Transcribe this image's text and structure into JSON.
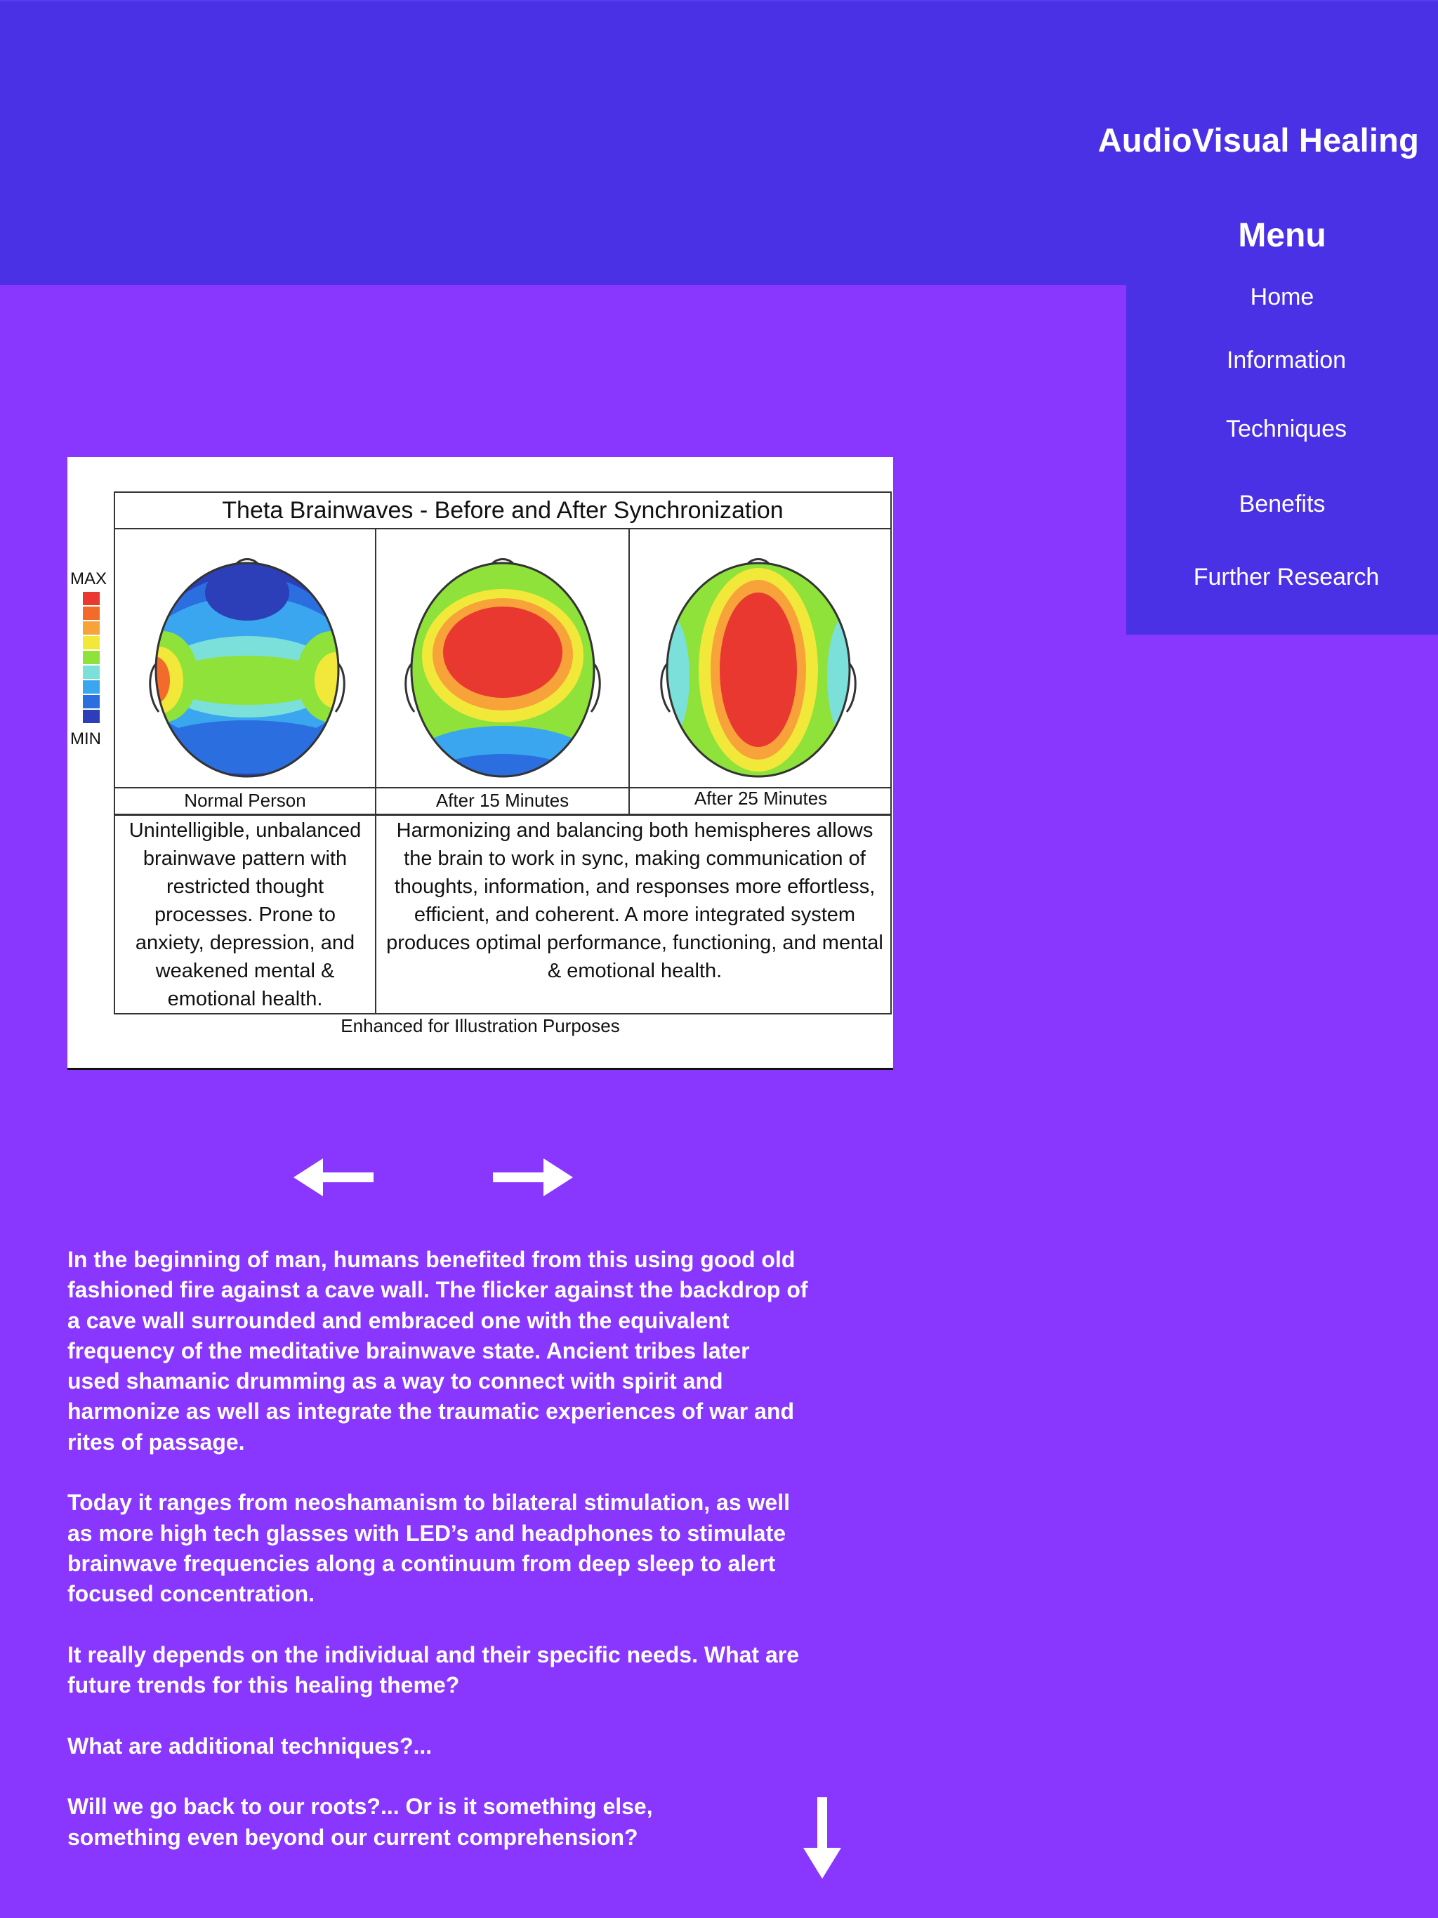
{
  "header": {
    "site_title": "AudioVisual Healing"
  },
  "menu": {
    "heading": "Menu",
    "items": [
      {
        "label": "Home"
      },
      {
        "label": "Information"
      },
      {
        "label": "Techniques"
      },
      {
        "label": "Benefits"
      },
      {
        "label": "Further Research"
      }
    ]
  },
  "figure": {
    "title": "Theta Brainwaves - Before and After Synchronization",
    "scale_max": "MAX",
    "scale_min": "MIN",
    "scale_colors": [
      "#e8382f",
      "#f36b2b",
      "#f7a33a",
      "#f2e83a",
      "#8ee23a",
      "#7be0d9",
      "#3aa6ef",
      "#2a6ee0",
      "#2c3fb8"
    ],
    "panels": [
      {
        "label": "Normal Person"
      },
      {
        "label": "After 15 Minutes"
      },
      {
        "label": "After 25 Minutes"
      }
    ],
    "desc_left": "Unintelligible, unbalanced brainwave pattern with restricted thought processes. Prone to anxiety, depression, and weakened mental & emotional health.",
    "desc_right": "Harmonizing and balancing both hemispheres allows the brain to work in sync, making communication of thoughts, information, and responses more effortless, efficient, and coherent. A more integrated system produces optimal performance, functioning, and mental & emotional health.",
    "caption": "Enhanced for Illustration Purposes"
  },
  "carousel": {
    "prev_icon": "arrow-left-icon",
    "next_icon": "arrow-right-icon"
  },
  "body": {
    "paragraphs": [
      "In the beginning of man, humans benefited from this using good old fashioned fire against a cave wall. The flicker against the backdrop of a cave wall surrounded and embraced one with the equivalent frequency of the meditative brainwave state. Ancient tribes later used shamanic drumming as a way to connect with spirit and harmonize as well as integrate the traumatic experiences of war and rites of passage.",
      "Today it ranges from neoshamanism to bilateral stimulation, as well as more high tech glasses with LED’s and headphones to stimulate brainwave frequencies along a continuum from deep sleep to alert focused concentration.",
      "It really depends on the individual and their specific needs. What are future trends for this healing theme?",
      "What are additional techniques?...",
      "Will we go back to our roots?... Or is it something else, something even beyond our current comprehension?"
    ]
  },
  "colors": {
    "background": "#8936fe",
    "header": "#4a31e6",
    "text": "#ffffff"
  }
}
